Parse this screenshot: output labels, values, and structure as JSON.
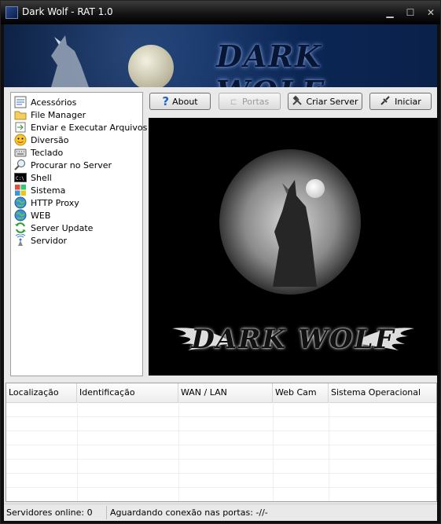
{
  "window": {
    "title": "Dark Wolf - RAT 1.0"
  },
  "banner": {
    "logo_text": "DARK WOLF"
  },
  "menu_tree": {
    "items": [
      {
        "label": "Acessórios",
        "icon": "accessories-icon"
      },
      {
        "label": "File Manager",
        "icon": "folder-icon"
      },
      {
        "label": "Enviar e Executar Arquivos",
        "icon": "send-file-icon"
      },
      {
        "label": "Diversão",
        "icon": "smiley-icon"
      },
      {
        "label": "Teclado",
        "icon": "keyboard-icon"
      },
      {
        "label": "Procurar no Server",
        "icon": "magnifier-icon"
      },
      {
        "label": "Shell",
        "icon": "console-icon"
      },
      {
        "label": "Sistema",
        "icon": "windows-flag-icon"
      },
      {
        "label": "HTTP Proxy",
        "icon": "globe-icon"
      },
      {
        "label": "WEB",
        "icon": "globe-icon"
      },
      {
        "label": "Server Update",
        "icon": "refresh-icon"
      },
      {
        "label": "Servidor",
        "icon": "antenna-icon"
      }
    ]
  },
  "toolbar": {
    "about": "About",
    "portas": "Portas",
    "criar_server": "Criar Server",
    "iniciar": "Iniciar"
  },
  "preview": {
    "logo_text": "DARK WOLF"
  },
  "connections_table": {
    "columns": [
      "Localização",
      "Identificação",
      "WAN / LAN",
      "Web Cam",
      "Sistema Operacional"
    ],
    "rows": []
  },
  "status": {
    "online": "Servidores online: 0",
    "waiting": "Aguardando conexão nas portas: -//-"
  }
}
